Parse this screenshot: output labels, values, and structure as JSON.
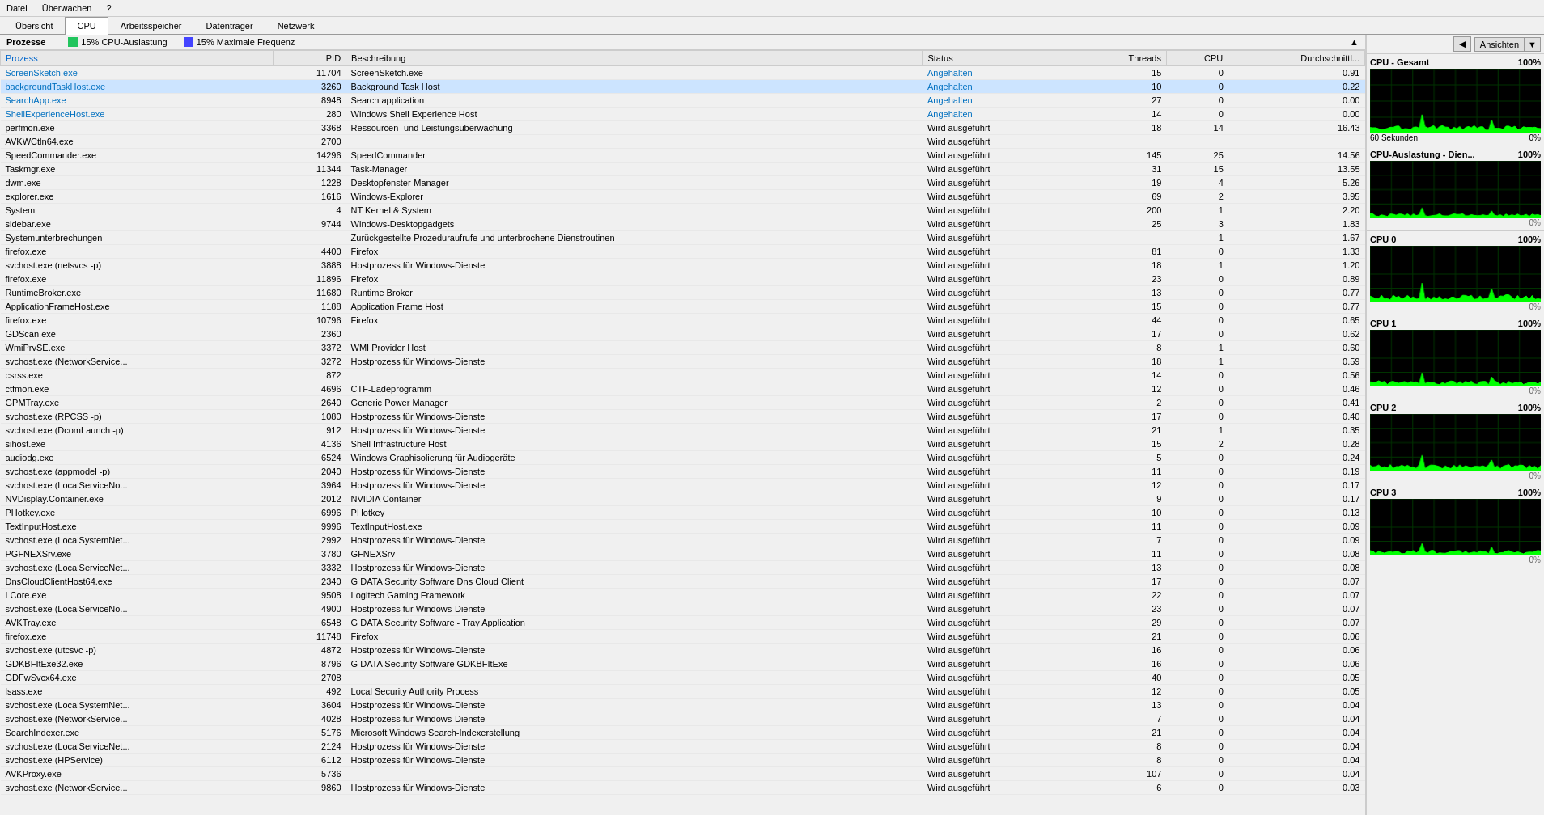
{
  "menubar": {
    "items": [
      "Datei",
      "Überwachen",
      "?"
    ]
  },
  "tabs": {
    "items": [
      "Übersicht",
      "CPU",
      "Arbeitsspeicher",
      "Datenträger",
      "Netzwerk"
    ],
    "active": "CPU"
  },
  "legend": {
    "cpu_label": "15% CPU-Auslastung",
    "freq_label": "15% Maximale Frequenz",
    "cpu_color": "#22c55e",
    "freq_color": "#4444ff"
  },
  "table": {
    "headers": [
      "Prozess",
      "PID",
      "Beschreibung",
      "Status",
      "Threads",
      "CPU",
      "Durchschnittl..."
    ],
    "rows": [
      {
        "process": "ScreenSketch.exe",
        "pid": "11704",
        "desc": "ScreenSketch.exe",
        "status": "Angehalten",
        "threads": "15",
        "cpu": "0",
        "avg": "0.91",
        "suspended": true
      },
      {
        "process": "backgroundTaskHost.exe",
        "pid": "3260",
        "desc": "Background Task Host",
        "status": "Angehalten",
        "threads": "10",
        "cpu": "0",
        "avg": "0.22",
        "suspended": true,
        "selected": true
      },
      {
        "process": "SearchApp.exe",
        "pid": "8948",
        "desc": "Search application",
        "status": "Angehalten",
        "threads": "27",
        "cpu": "0",
        "avg": "0.00",
        "suspended": true
      },
      {
        "process": "ShellExperienceHost.exe",
        "pid": "280",
        "desc": "Windows Shell Experience Host",
        "status": "Angehalten",
        "threads": "14",
        "cpu": "0",
        "avg": "0.00",
        "suspended": true
      },
      {
        "process": "perfmon.exe",
        "pid": "3368",
        "desc": "Ressourcen- und Leistungsüberwachung",
        "status": "Wird ausgeführt",
        "threads": "18",
        "cpu": "14",
        "avg": "16.43",
        "suspended": false
      },
      {
        "process": "AVKWCtln64.exe",
        "pid": "2700",
        "desc": "",
        "status": "Wird ausgeführt",
        "threads": "",
        "cpu": "",
        "avg": "",
        "suspended": false
      },
      {
        "process": "SpeedCommander.exe",
        "pid": "14296",
        "desc": "SpeedCommander",
        "status": "Wird ausgeführt",
        "threads": "145",
        "cpu": "25",
        "avg": "14.56",
        "suspended": false
      },
      {
        "process": "Taskmgr.exe",
        "pid": "11344",
        "desc": "Task-Manager",
        "status": "Wird ausgeführt",
        "threads": "31",
        "cpu": "15",
        "avg": "13.55",
        "suspended": false
      },
      {
        "process": "dwm.exe",
        "pid": "1228",
        "desc": "Desktopfenster-Manager",
        "status": "Wird ausgeführt",
        "threads": "19",
        "cpu": "4",
        "avg": "5.26",
        "suspended": false
      },
      {
        "process": "explorer.exe",
        "pid": "1616",
        "desc": "Windows-Explorer",
        "status": "Wird ausgeführt",
        "threads": "69",
        "cpu": "2",
        "avg": "3.95",
        "suspended": false
      },
      {
        "process": "System",
        "pid": "4",
        "desc": "NT Kernel & System",
        "status": "Wird ausgeführt",
        "threads": "200",
        "cpu": "1",
        "avg": "2.20",
        "suspended": false
      },
      {
        "process": "sidebar.exe",
        "pid": "9744",
        "desc": "Windows-Desktopgadgets",
        "status": "Wird ausgeführt",
        "threads": "25",
        "cpu": "3",
        "avg": "1.83",
        "suspended": false
      },
      {
        "process": "Systemunterbrechungen",
        "pid": "-",
        "desc": "Zurückgestellte Prozeduraufrufe und unterbrochene Dienstroutinen",
        "status": "Wird ausgeführt",
        "threads": "-",
        "cpu": "1",
        "avg": "1.67",
        "suspended": false
      },
      {
        "process": "firefox.exe",
        "pid": "4400",
        "desc": "Firefox",
        "status": "Wird ausgeführt",
        "threads": "81",
        "cpu": "0",
        "avg": "1.33",
        "suspended": false
      },
      {
        "process": "svchost.exe (netsvcs -p)",
        "pid": "3888",
        "desc": "Hostprozess für Windows-Dienste",
        "status": "Wird ausgeführt",
        "threads": "18",
        "cpu": "1",
        "avg": "1.20",
        "suspended": false
      },
      {
        "process": "firefox.exe",
        "pid": "11896",
        "desc": "Firefox",
        "status": "Wird ausgeführt",
        "threads": "23",
        "cpu": "0",
        "avg": "0.89",
        "suspended": false
      },
      {
        "process": "RuntimeBroker.exe",
        "pid": "11680",
        "desc": "Runtime Broker",
        "status": "Wird ausgeführt",
        "threads": "13",
        "cpu": "0",
        "avg": "0.77",
        "suspended": false
      },
      {
        "process": "ApplicationFrameHost.exe",
        "pid": "1188",
        "desc": "Application Frame Host",
        "status": "Wird ausgeführt",
        "threads": "15",
        "cpu": "0",
        "avg": "0.77",
        "suspended": false
      },
      {
        "process": "firefox.exe",
        "pid": "10796",
        "desc": "Firefox",
        "status": "Wird ausgeführt",
        "threads": "44",
        "cpu": "0",
        "avg": "0.65",
        "suspended": false
      },
      {
        "process": "GDScan.exe",
        "pid": "2360",
        "desc": "",
        "status": "Wird ausgeführt",
        "threads": "17",
        "cpu": "0",
        "avg": "0.62",
        "suspended": false
      },
      {
        "process": "WmiPrvSE.exe",
        "pid": "3372",
        "desc": "WMI Provider Host",
        "status": "Wird ausgeführt",
        "threads": "8",
        "cpu": "1",
        "avg": "0.60",
        "suspended": false
      },
      {
        "process": "svchost.exe (NetworkService...",
        "pid": "3272",
        "desc": "Hostprozess für Windows-Dienste",
        "status": "Wird ausgeführt",
        "threads": "18",
        "cpu": "1",
        "avg": "0.59",
        "suspended": false
      },
      {
        "process": "csrss.exe",
        "pid": "872",
        "desc": "",
        "status": "Wird ausgeführt",
        "threads": "14",
        "cpu": "0",
        "avg": "0.56",
        "suspended": false
      },
      {
        "process": "ctfmon.exe",
        "pid": "4696",
        "desc": "CTF-Ladeprogramm",
        "status": "Wird ausgeführt",
        "threads": "12",
        "cpu": "0",
        "avg": "0.46",
        "suspended": false
      },
      {
        "process": "GPMTray.exe",
        "pid": "2640",
        "desc": "Generic Power Manager",
        "status": "Wird ausgeführt",
        "threads": "2",
        "cpu": "0",
        "avg": "0.41",
        "suspended": false
      },
      {
        "process": "svchost.exe (RPCSS -p)",
        "pid": "1080",
        "desc": "Hostprozess für Windows-Dienste",
        "status": "Wird ausgeführt",
        "threads": "17",
        "cpu": "0",
        "avg": "0.40",
        "suspended": false
      },
      {
        "process": "svchost.exe (DcomLaunch -p)",
        "pid": "912",
        "desc": "Hostprozess für Windows-Dienste",
        "status": "Wird ausgeführt",
        "threads": "21",
        "cpu": "1",
        "avg": "0.35",
        "suspended": false
      },
      {
        "process": "sihost.exe",
        "pid": "4136",
        "desc": "Shell Infrastructure Host",
        "status": "Wird ausgeführt",
        "threads": "15",
        "cpu": "2",
        "avg": "0.28",
        "suspended": false
      },
      {
        "process": "audiodg.exe",
        "pid": "6524",
        "desc": "Windows Graphisolierung für Audiogeräte",
        "status": "Wird ausgeführt",
        "threads": "5",
        "cpu": "0",
        "avg": "0.24",
        "suspended": false
      },
      {
        "process": "svchost.exe (appmodel -p)",
        "pid": "2040",
        "desc": "Hostprozess für Windows-Dienste",
        "status": "Wird ausgeführt",
        "threads": "11",
        "cpu": "0",
        "avg": "0.19",
        "suspended": false
      },
      {
        "process": "svchost.exe (LocalServiceNo...",
        "pid": "3964",
        "desc": "Hostprozess für Windows-Dienste",
        "status": "Wird ausgeführt",
        "threads": "12",
        "cpu": "0",
        "avg": "0.17",
        "suspended": false
      },
      {
        "process": "NVDisplay.Container.exe",
        "pid": "2012",
        "desc": "NVIDIA Container",
        "status": "Wird ausgeführt",
        "threads": "9",
        "cpu": "0",
        "avg": "0.17",
        "suspended": false
      },
      {
        "process": "PHotkey.exe",
        "pid": "6996",
        "desc": "PHotkey",
        "status": "Wird ausgeführt",
        "threads": "10",
        "cpu": "0",
        "avg": "0.13",
        "suspended": false
      },
      {
        "process": "TextInputHost.exe",
        "pid": "9996",
        "desc": "TextInputHost.exe",
        "status": "Wird ausgeführt",
        "threads": "11",
        "cpu": "0",
        "avg": "0.09",
        "suspended": false
      },
      {
        "process": "svchost.exe (LocalSystemNet...",
        "pid": "2992",
        "desc": "Hostprozess für Windows-Dienste",
        "status": "Wird ausgeführt",
        "threads": "7",
        "cpu": "0",
        "avg": "0.09",
        "suspended": false
      },
      {
        "process": "PGFNEXSrv.exe",
        "pid": "3780",
        "desc": "GFNEXSrv",
        "status": "Wird ausgeführt",
        "threads": "11",
        "cpu": "0",
        "avg": "0.08",
        "suspended": false
      },
      {
        "process": "svchost.exe (LocalServiceNet...",
        "pid": "3332",
        "desc": "Hostprozess für Windows-Dienste",
        "status": "Wird ausgeführt",
        "threads": "13",
        "cpu": "0",
        "avg": "0.08",
        "suspended": false
      },
      {
        "process": "DnsCloudClientHost64.exe",
        "pid": "2340",
        "desc": "G DATA Security Software Dns Cloud Client",
        "status": "Wird ausgeführt",
        "threads": "17",
        "cpu": "0",
        "avg": "0.07",
        "suspended": false
      },
      {
        "process": "LCore.exe",
        "pid": "9508",
        "desc": "Logitech Gaming Framework",
        "status": "Wird ausgeführt",
        "threads": "22",
        "cpu": "0",
        "avg": "0.07",
        "suspended": false
      },
      {
        "process": "svchost.exe (LocalServiceNo...",
        "pid": "4900",
        "desc": "Hostprozess für Windows-Dienste",
        "status": "Wird ausgeführt",
        "threads": "23",
        "cpu": "0",
        "avg": "0.07",
        "suspended": false
      },
      {
        "process": "AVKTray.exe",
        "pid": "6548",
        "desc": "G DATA Security Software - Tray Application",
        "status": "Wird ausgeführt",
        "threads": "29",
        "cpu": "0",
        "avg": "0.07",
        "suspended": false
      },
      {
        "process": "firefox.exe",
        "pid": "11748",
        "desc": "Firefox",
        "status": "Wird ausgeführt",
        "threads": "21",
        "cpu": "0",
        "avg": "0.06",
        "suspended": false
      },
      {
        "process": "svchost.exe (utcsvc -p)",
        "pid": "4872",
        "desc": "Hostprozess für Windows-Dienste",
        "status": "Wird ausgeführt",
        "threads": "16",
        "cpu": "0",
        "avg": "0.06",
        "suspended": false
      },
      {
        "process": "GDKBFItExe32.exe",
        "pid": "8796",
        "desc": "G DATA Security Software GDKBFItExe",
        "status": "Wird ausgeführt",
        "threads": "16",
        "cpu": "0",
        "avg": "0.06",
        "suspended": false
      },
      {
        "process": "GDFwSvcx64.exe",
        "pid": "2708",
        "desc": "",
        "status": "Wird ausgeführt",
        "threads": "40",
        "cpu": "0",
        "avg": "0.05",
        "suspended": false
      },
      {
        "process": "lsass.exe",
        "pid": "492",
        "desc": "Local Security Authority Process",
        "status": "Wird ausgeführt",
        "threads": "12",
        "cpu": "0",
        "avg": "0.05",
        "suspended": false
      },
      {
        "process": "svchost.exe (LocalSystemNet...",
        "pid": "3604",
        "desc": "Hostprozess für Windows-Dienste",
        "status": "Wird ausgeführt",
        "threads": "13",
        "cpu": "0",
        "avg": "0.04",
        "suspended": false
      },
      {
        "process": "svchost.exe (NetworkService...",
        "pid": "4028",
        "desc": "Hostprozess für Windows-Dienste",
        "status": "Wird ausgeführt",
        "threads": "7",
        "cpu": "0",
        "avg": "0.04",
        "suspended": false
      },
      {
        "process": "SearchIndexer.exe",
        "pid": "5176",
        "desc": "Microsoft Windows Search-Indexerstellung",
        "status": "Wird ausgeführt",
        "threads": "21",
        "cpu": "0",
        "avg": "0.04",
        "suspended": false
      },
      {
        "process": "svchost.exe (LocalServiceNet...",
        "pid": "2124",
        "desc": "Hostprozess für Windows-Dienste",
        "status": "Wird ausgeführt",
        "threads": "8",
        "cpu": "0",
        "avg": "0.04",
        "suspended": false
      },
      {
        "process": "svchost.exe (HPService)",
        "pid": "6112",
        "desc": "Hostprozess für Windows-Dienste",
        "status": "Wird ausgeführt",
        "threads": "8",
        "cpu": "0",
        "avg": "0.04",
        "suspended": false
      },
      {
        "process": "AVKProxy.exe",
        "pid": "5736",
        "desc": "",
        "status": "Wird ausgeführt",
        "threads": "107",
        "cpu": "0",
        "avg": "0.04",
        "suspended": false
      },
      {
        "process": "svchost.exe (NetworkService...",
        "pid": "9860",
        "desc": "Hostprozess für Windows-Dienste",
        "status": "Wird ausgeführt",
        "threads": "6",
        "cpu": "0",
        "avg": "0.03",
        "suspended": false
      }
    ]
  },
  "cpu_panel": {
    "title": "CPU - Gesamt",
    "percent_label": "100%",
    "duration_label": "60 Sekunden",
    "usage_pct": "0%",
    "sections": [
      {
        "label": "CPU-Auslastung - Dien...",
        "percent": "100%",
        "usage": "0%"
      },
      {
        "label": "CPU 0",
        "percent": "100%",
        "usage": "0%"
      },
      {
        "label": "CPU 1",
        "percent": "100%",
        "usage": "0%"
      },
      {
        "label": "CPU 2",
        "percent": "100%",
        "usage": "0%"
      },
      {
        "label": "CPU 3",
        "percent": "100%",
        "usage": "0%"
      }
    ]
  },
  "ansichten_label": "Ansichten",
  "processes_label": "Prozesse"
}
